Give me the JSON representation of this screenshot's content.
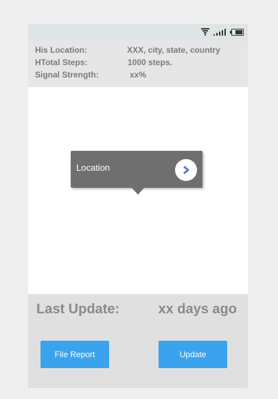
{
  "status_bar": {
    "icons": [
      "wifi-icon",
      "signal-icon",
      "battery-icon"
    ]
  },
  "info": {
    "location": {
      "label": "His Location:",
      "value": "XXX, city, state, country"
    },
    "steps": {
      "label": "HTotal Steps:",
      "value": "1000 steps."
    },
    "signal": {
      "label": "Signal Strength:",
      "value": "xx%"
    }
  },
  "map": {
    "tooltip": {
      "label": "Location",
      "action_icon": "chevron-right-icon"
    }
  },
  "last_update": {
    "label": "Last Update:",
    "value": "xx days ago"
  },
  "buttons": {
    "file_report": "File Report",
    "update": "Update"
  },
  "colors": {
    "accent": "#3ba3ee",
    "tooltip_bg": "#6f6f6f",
    "chevron": "#5b7fbd"
  }
}
